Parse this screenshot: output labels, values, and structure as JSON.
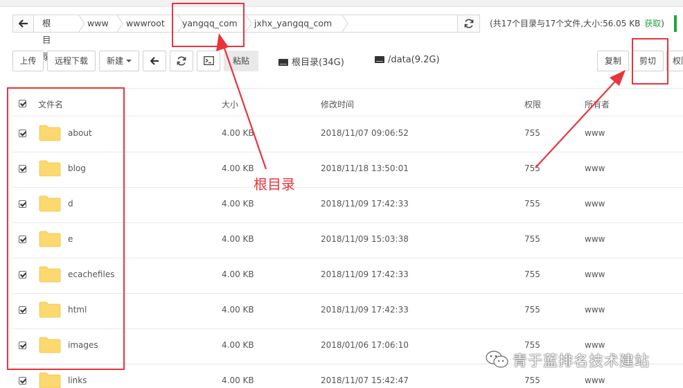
{
  "breadcrumb": {
    "items": [
      "根目录",
      "www",
      "wwwroot",
      "yangqq_com",
      "jxhx_yangqq_com"
    ]
  },
  "summary": {
    "text": "(共17个目录与17个文件,大小:56.05 KB",
    "link": "获取",
    "close": ")"
  },
  "toolbar": {
    "upload": "上传",
    "remote_download": "远程下载",
    "new": "新建",
    "paste": "粘贴",
    "disk_root": "根目录(34G)",
    "disk_data": "/data(9.2G)",
    "copy": "复制",
    "cut": "剪切",
    "permission": "权限"
  },
  "table": {
    "headers": {
      "name": "文件名",
      "size": "大小",
      "mtime": "修改时间",
      "perm": "权限",
      "owner": "所有者"
    },
    "rows": [
      {
        "name": "about",
        "size": "4.00 KB",
        "mtime": "2018/11/07 09:06:52",
        "perm": "755",
        "owner": "www",
        "checked": true
      },
      {
        "name": "blog",
        "size": "4.00 KB",
        "mtime": "2018/11/18 13:50:01",
        "perm": "755",
        "owner": "www",
        "checked": true
      },
      {
        "name": "d",
        "size": "4.00 KB",
        "mtime": "2018/11/09 17:42:33",
        "perm": "755",
        "owner": "www",
        "checked": true
      },
      {
        "name": "e",
        "size": "4.00 KB",
        "mtime": "2018/11/09 15:03:38",
        "perm": "755",
        "owner": "www",
        "checked": true
      },
      {
        "name": "ecachefiles",
        "size": "4.00 KB",
        "mtime": "2018/11/09 17:42:33",
        "perm": "755",
        "owner": "www",
        "checked": true
      },
      {
        "name": "html",
        "size": "4.00 KB",
        "mtime": "2018/11/09 17:42:33",
        "perm": "755",
        "owner": "www",
        "checked": true
      },
      {
        "name": "images",
        "size": "4.00 KB",
        "mtime": "2018/01/06 17:06:10",
        "perm": "755",
        "owner": "www",
        "checked": true
      },
      {
        "name": "links",
        "size": "4.00 KB",
        "mtime": "2018/11/07 15:42:47",
        "perm": "755",
        "owner": "www",
        "checked": true
      }
    ]
  },
  "annotation": {
    "label": "根目录"
  },
  "watermark": {
    "text": "青于蓝排名技术建站"
  },
  "colors": {
    "accent": "#20a53a",
    "annotation": "#e8343a",
    "folder": "#fbd96e"
  }
}
